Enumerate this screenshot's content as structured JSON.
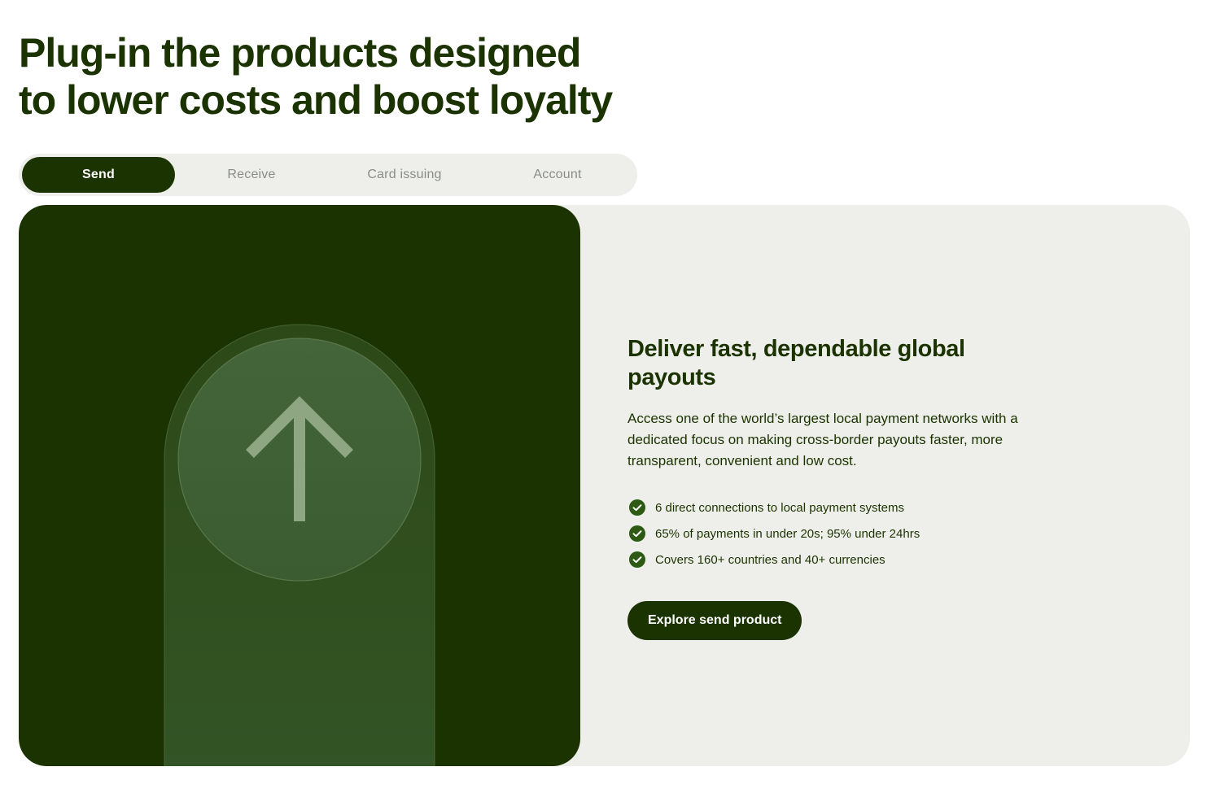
{
  "headline": {
    "line1": "Plug-in the products designed",
    "line2": "to lower costs and boost loyalty"
  },
  "tabs": [
    {
      "label": "Send",
      "active": true
    },
    {
      "label": "Receive",
      "active": false
    },
    {
      "label": "Card issuing",
      "active": false
    },
    {
      "label": "Account",
      "active": false
    }
  ],
  "panel": {
    "visual_icon": "arrow-up-icon",
    "title": "Deliver fast, dependable global payouts",
    "description": "Access one of the world’s largest local payment networks with a dedicated focus on making cross-border payouts faster, more transparent, convenient and low cost.",
    "features": [
      "6 direct connections to local payment systems",
      "65% of payments in under 20s; 95% under 24hrs",
      "Covers 160+ countries and 40+ currencies"
    ],
    "cta_label": "Explore send product"
  },
  "colors": {
    "brand_dark_green": "#1b3300",
    "card_background": "#eeefea",
    "tab_bar_background": "#eeefeb",
    "tab_inactive_text": "#8a8d86",
    "check_icon": "#2c5a12"
  }
}
